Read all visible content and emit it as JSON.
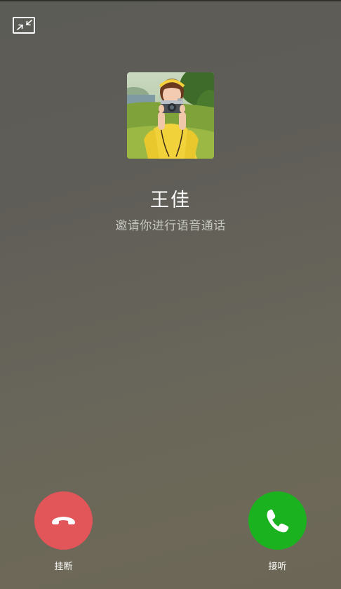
{
  "caller": {
    "name": "王佳",
    "status_text": "邀请你进行语音通话",
    "avatar": "photo"
  },
  "controls": {
    "minimize_icon": "minimize-arrows-icon",
    "decline_label": "挂断",
    "accept_label": "接听",
    "decline_color": "#e25558",
    "accept_color": "#1bb21f"
  }
}
